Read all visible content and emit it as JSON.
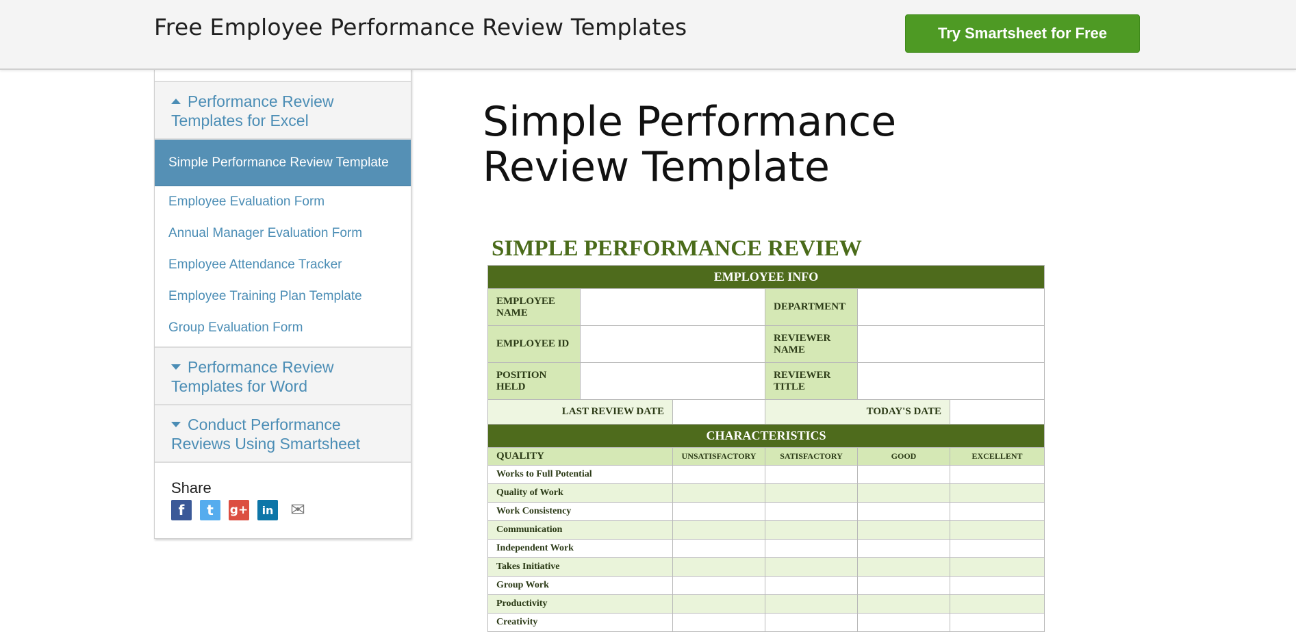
{
  "header": {
    "title": "Free Employee Performance Review Templates",
    "cta_label": "Try Smartsheet for Free"
  },
  "sidebar": {
    "section_excel": "Performance Review Templates for Excel",
    "items": [
      {
        "label": "Simple Performance Review Template",
        "active": true
      },
      {
        "label": "Employee Evaluation Form"
      },
      {
        "label": "Annual Manager Evaluation Form"
      },
      {
        "label": "Employee Attendance Tracker"
      },
      {
        "label": "Employee Training Plan Template"
      },
      {
        "label": "Group Evaluation Form"
      }
    ],
    "section_word": "Performance Review Templates for Word",
    "section_smartsheet": "Conduct Performance Reviews Using Smartsheet",
    "share_label": "Share",
    "share_icons": [
      "facebook-icon",
      "twitter-icon",
      "google-plus-icon",
      "linkedin-icon",
      "email-icon"
    ]
  },
  "main": {
    "title": "Simple Performance Review Template"
  },
  "review": {
    "title": "SIMPLE PERFORMANCE REVIEW",
    "employee_info_header": "EMPLOYEE INFO",
    "labels": {
      "employee_name": "EMPLOYEE NAME",
      "department": "DEPARTMENT",
      "employee_id": "EMPLOYEE ID",
      "reviewer_name": "REVIEWER NAME",
      "position_held": "POSITION HELD",
      "reviewer_title": "REVIEWER TITLE",
      "last_review_date": "LAST REVIEW DATE",
      "todays_date": "TODAY'S DATE"
    },
    "characteristics_header": "CHARACTERISTICS",
    "columns": [
      "QUALITY",
      "UNSATISFACTORY",
      "SATISFACTORY",
      "GOOD",
      "EXCELLENT"
    ],
    "qualities": [
      "Works to Full Potential",
      "Quality of Work",
      "Work Consistency",
      "Communication",
      "Independent Work",
      "Takes Initiative",
      "Group Work",
      "Productivity",
      "Creativity"
    ]
  }
}
